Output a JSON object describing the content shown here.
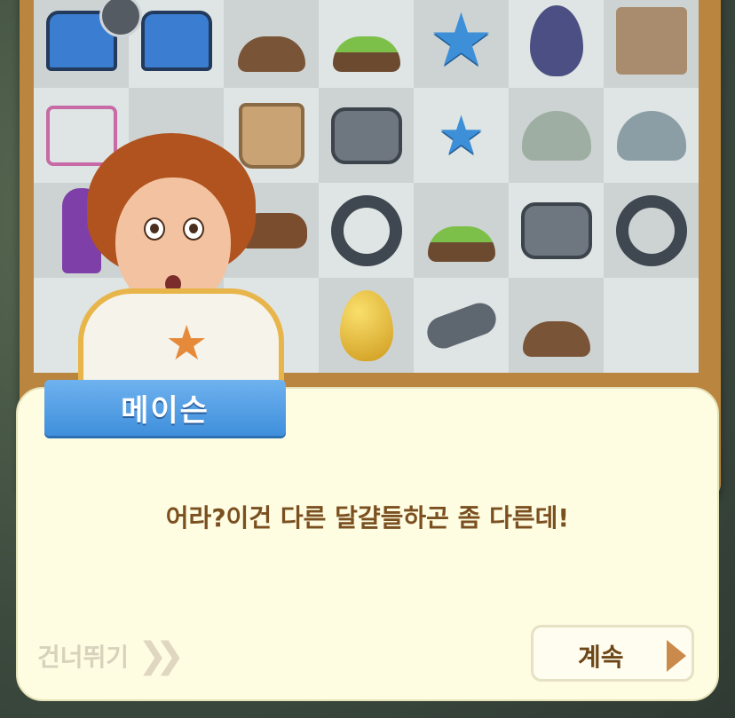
{
  "dialog": {
    "speaker_name": "메이슨",
    "message": "어라?이건 다른 달걀들하곤 좀 다른데!",
    "skip_label": "건너뛰기",
    "skip_arrows": "❯❯",
    "continue_label": "계속"
  },
  "board": {
    "rows": [
      [
        "blue-treasure-chest-icon",
        "blue-treasure-chest-icon",
        "shovel-dirt-mound-icon",
        "grass-mound-flag-icon",
        "blue-star-icon",
        "cobweb-egg-icon",
        "cardboard-box-icon"
      ],
      [
        "pink-bicycle-icon",
        "handlebar-icon",
        "bike-basket-icon",
        "bike-pedal-icon",
        "small-blue-star-icon",
        "cobweb-bush-icon",
        "cobweb-rock-icon"
      ],
      [
        "superhero-figure-icon",
        "empty",
        "bike-seat-icon",
        "tire-icon",
        "grass-mound-icon",
        "bike-pedal-icon",
        "tire-icon"
      ],
      [
        "toy-blaster-icon",
        "empty",
        "empty",
        "golden-egg-icon",
        "bike-grip-icon",
        "dirt-mound-sprout-icon",
        "empty"
      ]
    ]
  },
  "colors": {
    "nameplate": "#3f8fdc",
    "dialog_bg": "#fefde2",
    "message_text": "#7b5020",
    "continue_arrow": "#c98a4c"
  }
}
